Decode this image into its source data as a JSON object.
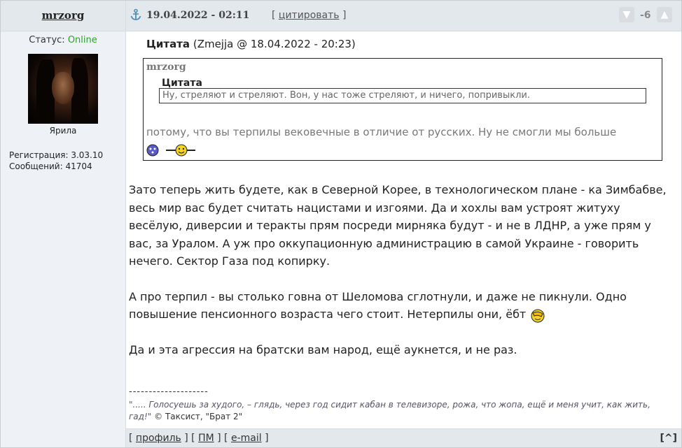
{
  "author": {
    "name": "mrzorg",
    "status_label": "Статус:",
    "status_value": "Online",
    "avatar_caption": "Ярила",
    "registration": "Регистрация: 3.03.10",
    "messages": "Сообщений: 41704"
  },
  "header": {
    "date": "19.04.2022 - 02:11",
    "quote_open": "[",
    "quote_label": "цитировать",
    "quote_close": "]",
    "rating": "-6"
  },
  "quote": {
    "title": "Цитата",
    "source": "(Zmejja @ 18.04.2022 - 20:23)",
    "inner_author": "mrzorg",
    "inner_title": "Цитата",
    "inner_text": "Ну, стреляют и стреляют. Вон, у нас тоже стреляют, и ничего, попривыкли.",
    "text": "потому, что вы терпилы вековечные в отличие от русских. Ну не смогли мы больше"
  },
  "body": {
    "p1": "Зато теперь жить будете, как в Северной Корее, в технологическом плане - ка Зимбабве, весь мир вас будет считать нацистами и изгоями. Да и хохлы вам устроят житуху весёлую, диверсии и теракты прям посреди мирняка будут - и не в ЛДНР, а уже прям у вас, за Уралом. А уж про оккупационную администрацию в самой Украине - говорить нечего. Сектор Газа под копирку.",
    "p2": "А про терпил - вы столько говна от Шеломова сглотнули, и даже не пикнули. Одно повышение пенсионного возраста чего стоит. Нетерпилы они, ёбт",
    "p3": "Да и эта агрессия на братски вам народ, ещё аукнется, и не раз."
  },
  "signature": {
    "line": "--------------------",
    "quote": "\"..... Голосуешь за худого, – глядь, через год сидит кабан в телевизоре, рожа, что жопа, ещё и меня учит, как жить, гад!\"",
    "attribution": "© Таксист, \"Брат 2\""
  },
  "footer": {
    "profile": "профиль",
    "pm": "ПМ",
    "email": "e-mail",
    "to_top": "[^]"
  },
  "colors": {
    "status_online": "#2ea12e",
    "header_bg": "#e3e8ed",
    "side_bg": "#eef2f6"
  }
}
